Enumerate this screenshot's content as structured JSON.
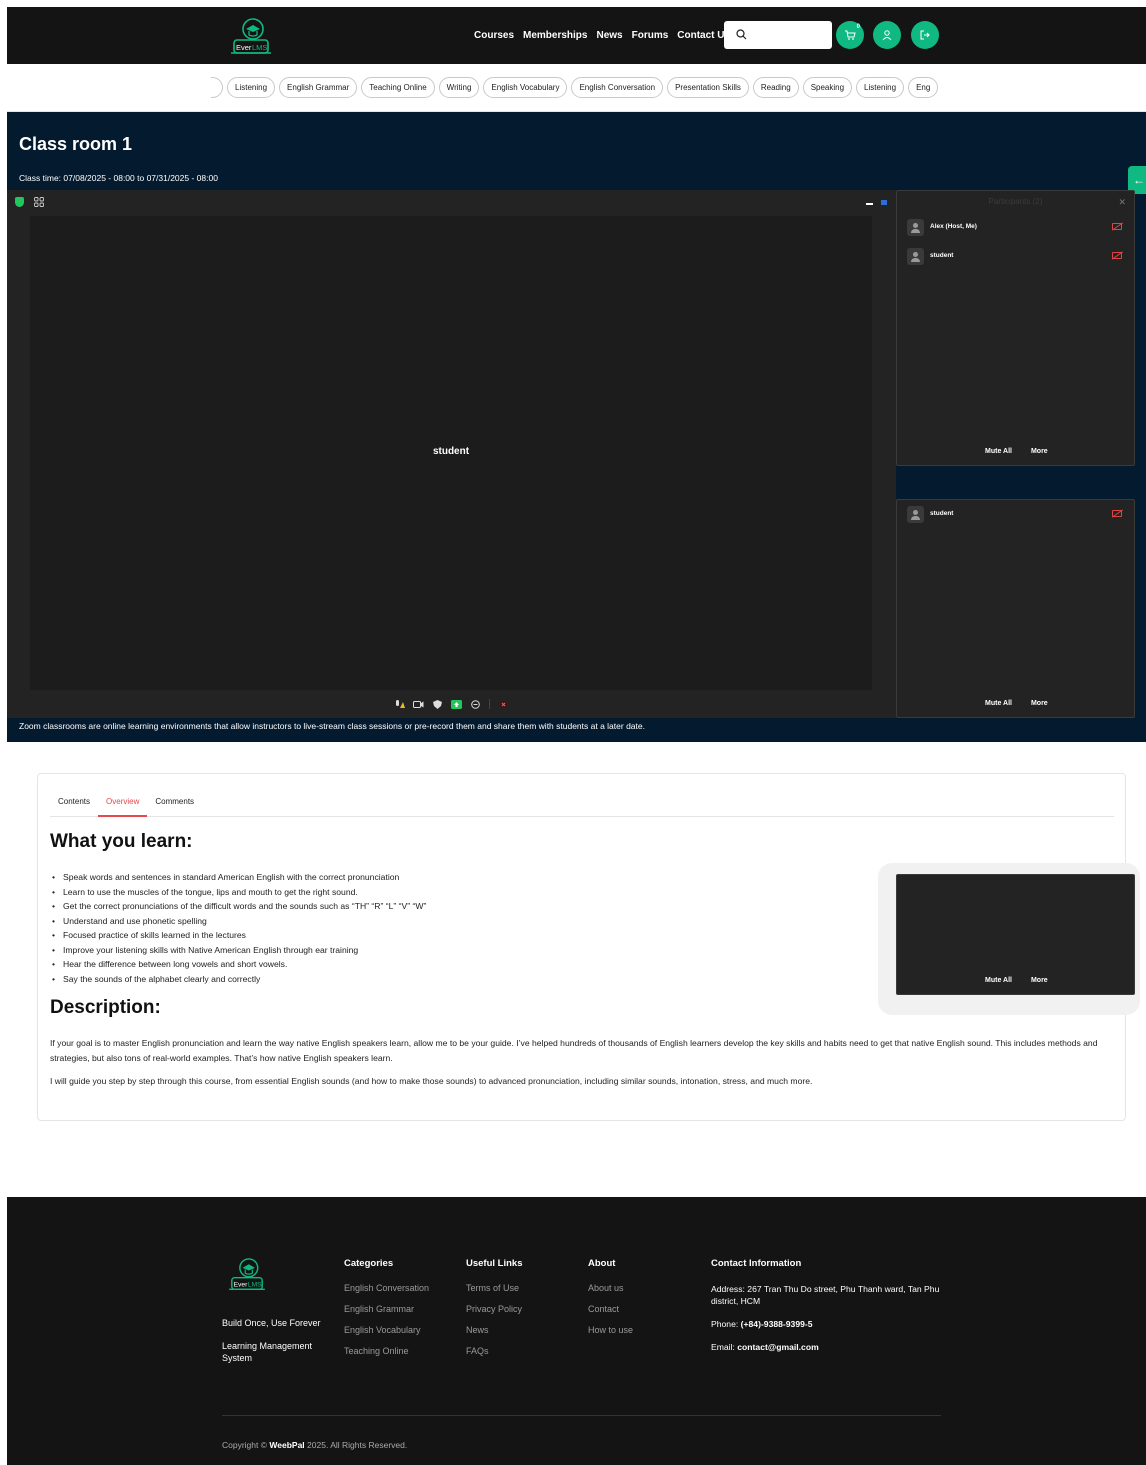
{
  "header": {
    "logo_text": "EverLMS",
    "nav": [
      "Courses",
      "Memberships",
      "News",
      "Forums",
      "Contact Us"
    ],
    "search": {
      "value": "",
      "placeholder": ""
    },
    "cart_count": "0"
  },
  "categories": [
    "Listening",
    "English Grammar",
    "Teaching Online",
    "Writing",
    "English Vocabulary",
    "English Conversation",
    "Presentation Skills",
    "Reading",
    "Speaking",
    "Listening",
    "Eng"
  ],
  "classroom": {
    "title": "Class room 1",
    "time": "Class time: 07/08/2025 - 08:00 to 07/31/2025 - 08:00",
    "video_name": "student",
    "caption": "Zoom classrooms are online learning environments that allow instructors to live-stream class sessions or pre-record them and share them with students at a later date.",
    "participants_panel": {
      "title": "Participants (2)",
      "participants": [
        "Alex (Host, Me)",
        "student"
      ],
      "mute_all": "Mute All",
      "more": "More"
    },
    "second_panel": {
      "participants": [
        "student"
      ],
      "mute_all": "Mute All",
      "more": "More"
    },
    "floating_panel": {
      "mute_all": "Mute All",
      "more": "More"
    }
  },
  "tabs": [
    "Contents",
    "Overview",
    "Comments"
  ],
  "active_tab": "Overview",
  "learn": {
    "heading": "What you learn:",
    "items": [
      "Speak words and sentences in standard American English with the correct pronunciation",
      "Learn to use the muscles of the tongue, lips and mouth to get the right sound.",
      "Get the correct pronunciations of the difficult words and the sounds such as “TH” “R” “L” “V” “W”",
      "Understand and use phonetic spelling",
      "Focused practice of skills learned in the lectures",
      "Improve your listening skills with Native American English through ear training",
      "Hear the difference between long vowels and short vowels.",
      "Say the sounds of the alphabet clearly and correctly"
    ]
  },
  "description": {
    "heading": "Description:",
    "p1": "If your goal is to master English pronunciation and learn the way native English speakers learn, allow me to be your guide. I’ve helped hundreds of thousands of English learners develop the key skills and habits need to get that native English sound. This includes methods and strategies, but also tons of real-world examples. That’s how native English speakers learn.",
    "p2": "I will guide you step by step through this course, from essential English sounds (and how to make those sounds) to advanced pronunciation, including similar sounds, intonation, stress, and much more."
  },
  "footer": {
    "tagline": "Build Once, Use Forever",
    "subtitle": "Learning Management System",
    "categories": {
      "title": "Categories",
      "links": [
        "English Conversation",
        "English Grammar",
        "English Vocabulary",
        "Teaching Online"
      ]
    },
    "useful": {
      "title": "Useful Links",
      "links": [
        "Terms of Use",
        "Privacy Policy",
        "News",
        "FAQs"
      ]
    },
    "about": {
      "title": "About",
      "links": [
        "About us",
        "Contact",
        "How to use"
      ]
    },
    "contact": {
      "title": "Contact Information",
      "address": "Address: 267 Tran Thu Do street, Phu Thanh ward, Tan Phu district, HCM",
      "phone_label": "Phone:",
      "phone": "(+84)-9388-9399-5",
      "email_label": "Email:",
      "email": "contact@gmail.com"
    },
    "copyright_prefix": "Copyright ©",
    "copyright_brand": "WeebPal",
    "copyright_suffix": "2025. All Rights Reserved."
  },
  "colors": {
    "accent": "#10b981",
    "hero_bg": "#041a2f",
    "active_tab": "#e5484d",
    "header_bg": "#141414"
  }
}
